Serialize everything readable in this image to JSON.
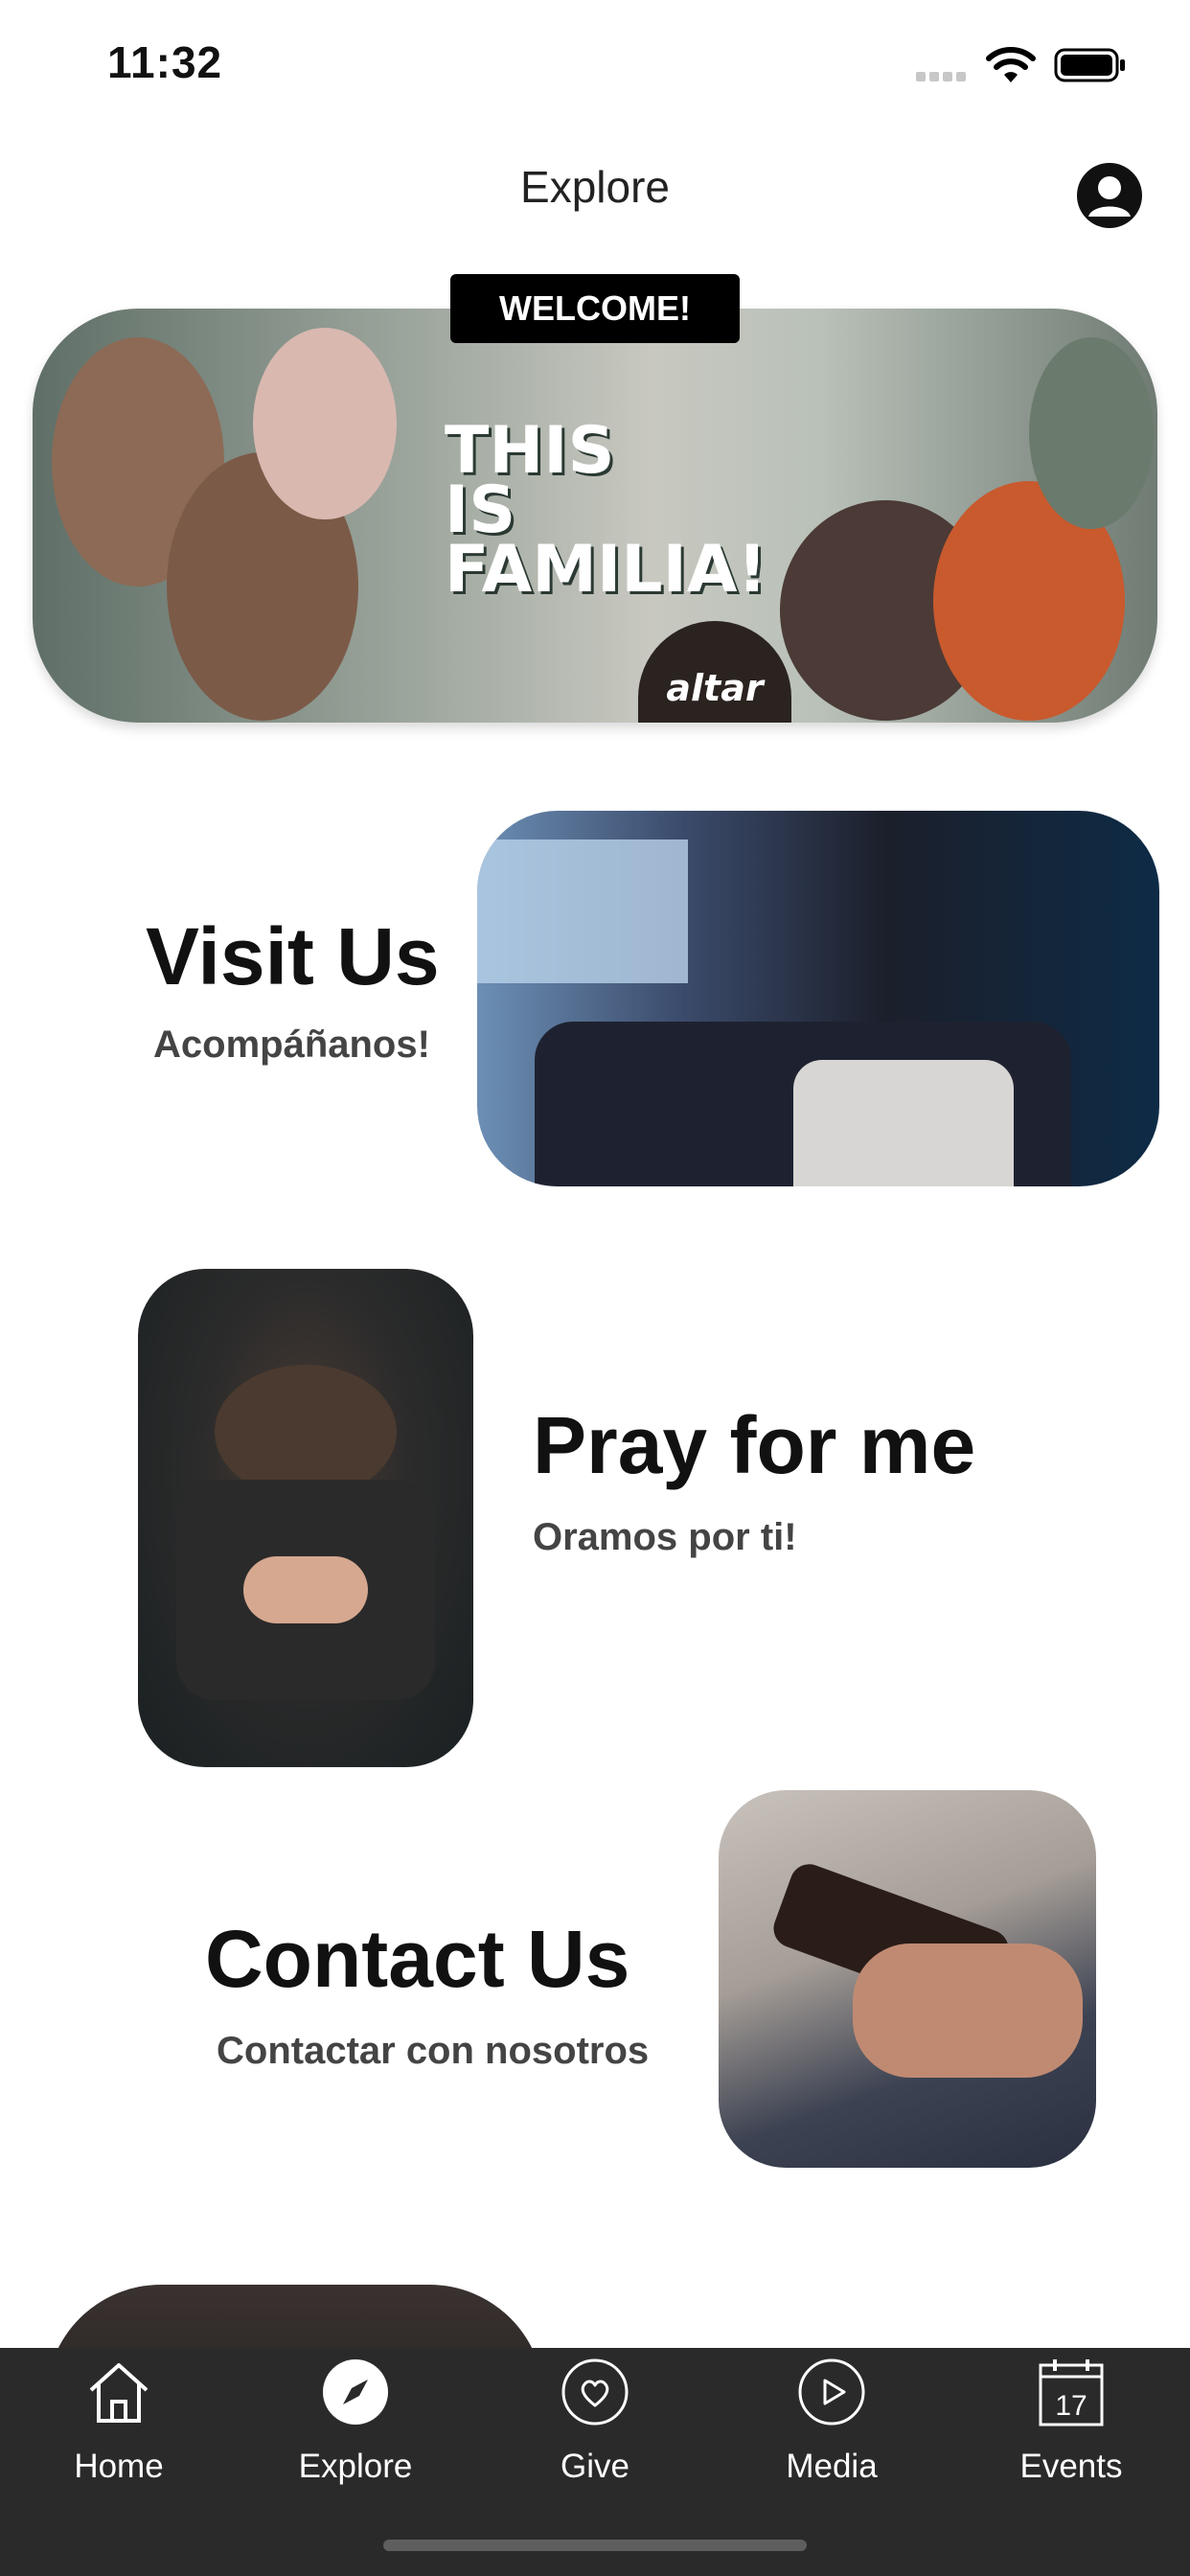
{
  "status_bar": {
    "time": "11:32"
  },
  "header": {
    "title": "Explore"
  },
  "hero": {
    "badge": "WELCOME!",
    "headline": [
      "THIS",
      "IS",
      "FAMILIA!"
    ],
    "logo_text": "altar"
  },
  "cards": [
    {
      "title": "Visit Us",
      "subtitle": "Acompáñanos!"
    },
    {
      "title": "Pray for me",
      "subtitle": "Oramos por ti!"
    },
    {
      "title": "Contact Us",
      "subtitle": "Contactar con nosotros"
    }
  ],
  "tabbar": {
    "items": [
      {
        "label": "Home",
        "icon": "home-icon"
      },
      {
        "label": "Explore",
        "icon": "compass-icon",
        "active": true
      },
      {
        "label": "Give",
        "icon": "heart-icon"
      },
      {
        "label": "Media",
        "icon": "play-icon"
      },
      {
        "label": "Events",
        "icon": "calendar-icon",
        "day": "17"
      }
    ]
  },
  "colors": {
    "tabbar_bg": "#2a2a2a",
    "badge_bg": "#000000",
    "text": "#111111",
    "subtitle": "#444444"
  }
}
